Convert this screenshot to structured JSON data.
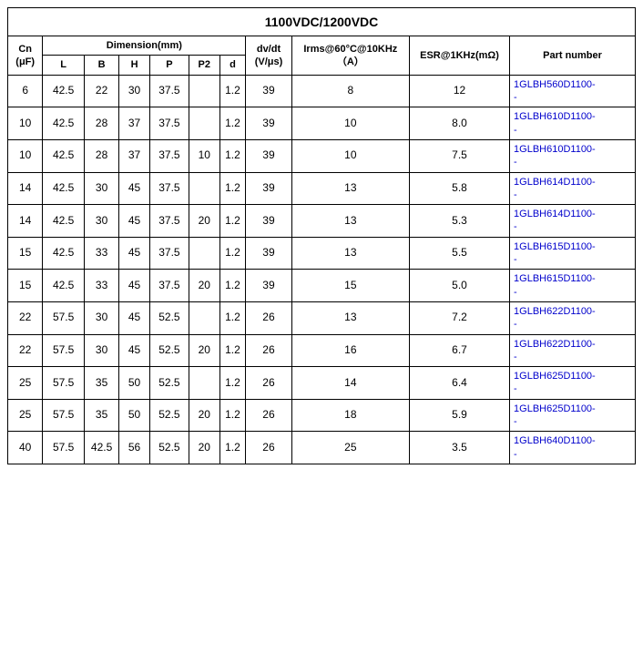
{
  "title": "1100VDC/1200VDC",
  "headers": {
    "cn": "Cn\n(μF)",
    "dimension": "Dimension(mm)",
    "dim_sub": [
      "L",
      "B",
      "H",
      "P",
      "P2",
      "d"
    ],
    "dvdt": "dv/dt\n(V/μs)",
    "irms": "Irms@60°C@10KHz\n（A）",
    "esr": "ESR@1KHz(mΩ)",
    "part_number": "Part number"
  },
  "rows": [
    {
      "cn": "6",
      "L": "42.5",
      "B": "22",
      "H": "30",
      "P": "37.5",
      "P2": "",
      "d": "1.2",
      "dvdt": "39",
      "irms": "8",
      "esr": "12",
      "part": "1GLBH560D1100-\n-"
    },
    {
      "cn": "10",
      "L": "42.5",
      "B": "28",
      "H": "37",
      "P": "37.5",
      "P2": "",
      "d": "1.2",
      "dvdt": "39",
      "irms": "10",
      "esr": "8.0",
      "part": "1GLBH610D1100-\n-"
    },
    {
      "cn": "10",
      "L": "42.5",
      "B": "28",
      "H": "37",
      "P": "37.5",
      "P2": "10",
      "d": "1.2",
      "dvdt": "39",
      "irms": "10",
      "esr": "7.5",
      "part": "1GLBH610D1100-\n-"
    },
    {
      "cn": "14",
      "L": "42.5",
      "B": "30",
      "H": "45",
      "P": "37.5",
      "P2": "",
      "d": "1.2",
      "dvdt": "39",
      "irms": "13",
      "esr": "5.8",
      "part": "1GLBH614D1100-\n-"
    },
    {
      "cn": "14",
      "L": "42.5",
      "B": "30",
      "H": "45",
      "P": "37.5",
      "P2": "20",
      "d": "1.2",
      "dvdt": "39",
      "irms": "13",
      "esr": "5.3",
      "part": "1GLBH614D1100-\n-"
    },
    {
      "cn": "15",
      "L": "42.5",
      "B": "33",
      "H": "45",
      "P": "37.5",
      "P2": "",
      "d": "1.2",
      "dvdt": "39",
      "irms": "13",
      "esr": "5.5",
      "part": "1GLBH615D1100-\n-"
    },
    {
      "cn": "15",
      "L": "42.5",
      "B": "33",
      "H": "45",
      "P": "37.5",
      "P2": "20",
      "d": "1.2",
      "dvdt": "39",
      "irms": "15",
      "esr": "5.0",
      "part": "1GLBH615D1100-\n-"
    },
    {
      "cn": "22",
      "L": "57.5",
      "B": "30",
      "H": "45",
      "P": "52.5",
      "P2": "",
      "d": "1.2",
      "dvdt": "26",
      "irms": "13",
      "esr": "7.2",
      "part": "1GLBH622D1100-\n-"
    },
    {
      "cn": "22",
      "L": "57.5",
      "B": "30",
      "H": "45",
      "P": "52.5",
      "P2": "20",
      "d": "1.2",
      "dvdt": "26",
      "irms": "16",
      "esr": "6.7",
      "part": "1GLBH622D1100-\n-"
    },
    {
      "cn": "25",
      "L": "57.5",
      "B": "35",
      "H": "50",
      "P": "52.5",
      "P2": "",
      "d": "1.2",
      "dvdt": "26",
      "irms": "14",
      "esr": "6.4",
      "part": "1GLBH625D1100-\n-"
    },
    {
      "cn": "25",
      "L": "57.5",
      "B": "35",
      "H": "50",
      "P": "52.5",
      "P2": "20",
      "d": "1.2",
      "dvdt": "26",
      "irms": "18",
      "esr": "5.9",
      "part": "1GLBH625D1100-\n-"
    },
    {
      "cn": "40",
      "L": "57.5",
      "B": "42.5",
      "H": "56",
      "P": "52.5",
      "P2": "20",
      "d": "1.2",
      "dvdt": "26",
      "irms": "25",
      "esr": "3.5",
      "part": "1GLBH640D1100-\n-"
    }
  ]
}
